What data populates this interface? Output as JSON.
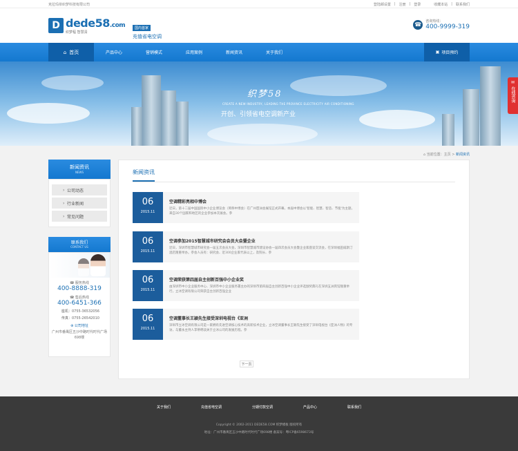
{
  "topbar": {
    "company": "克拉玛依织梦科技有限公司",
    "links": [
      "登陆邮设置",
      "注册",
      "登录",
      "收藏本站",
      "联系我们"
    ]
  },
  "header": {
    "logo_mark": "D",
    "logo_text": "dede58",
    "logo_suffix": ".com",
    "logo_tag": "织梦程  智慧清",
    "badge": "国内首家",
    "slogan": "充值省电空调",
    "hotline_label": "咨询热线：",
    "hotline": "400-9999-319"
  },
  "nav": {
    "home": "首页",
    "items": [
      "产品中心",
      "营销模式",
      "应用案例",
      "新闻资讯",
      "关于我们"
    ],
    "project": "项目预约"
  },
  "banner": {
    "title": "织梦58",
    "en": "CREATE A NEW INDUSTRY, LEADING THE PROVINCE ELECTRICITY AIR CONDITIONING",
    "sub": "开创、引领省电空调新产业"
  },
  "breadcrumb": {
    "prefix": "当前位置：主页 >",
    "current": "新闻资讯"
  },
  "sidebar": {
    "title": "新闻资讯",
    "title_en": "NEWS",
    "items": [
      "公司动态",
      "行业新闻",
      "常见问题"
    ],
    "contact_title": "联系我们",
    "contact_en": "CONTACT US",
    "service_label": "服务热线",
    "service_num": "400-8888-319",
    "after_label": "售后热线",
    "after_num": "400-6451-366",
    "landline": "座机：0755-36532056",
    "fax": "传真：0755-26542010",
    "addr_label": "公司地址",
    "addr": "广州市番禺区五沙中路时代时代广场698楼"
  },
  "main": {
    "title": "新闻资讯",
    "news": [
      {
        "day": "06",
        "month": "2015.11",
        "title": "空调精彩亮相中博会",
        "summary": "近日，第十二届中国国际中小企业博览会（简称中博会）在广州琶洲会展馆正式开幕，本届中博会以'智能、智慧、智造、节能'为主题，来自30个国家和地区的企业参加本次展会。参"
      },
      {
        "day": "06",
        "month": "2015.11",
        "title": "空调参加2015智慧城市研究会会员大会暨企业",
        "summary": "近日，深圳市智慧城市研究会一届五次会员大会，深圳市智慧城市建设协会一届四次会员大会暨企业家座谈交流会，在深圳福田威斯汀酒店隆重举办。参会人员有：研究会、近300企业家代表以上，及院长、参"
      },
      {
        "day": "06",
        "month": "2015.11",
        "title": "空调荣获第四届自主创新百强中小企业奖",
        "summary": "由深圳市中小企业服务中心、深圳市中小企业服务署主办的深圳市第四届自主创新百强中小企业评选颁奖典礼在深圳五洲宾馆隆重举行，立冰空调有限公司荣获自主创新百强企业"
      },
      {
        "day": "06",
        "month": "2015.11",
        "title": "空调董事长王颖先生接受深圳电视台《亚洲",
        "summary": "深圳市立冰空调有限公司是一家拥有先进空调核心技术的高新技术企业，立冰空调董事长王颖先生接受了深圳电视台《亚洲人物》的专访，与董永主持人李蒂韩谈关于立冰公司的发展历程。参"
      }
    ],
    "next": "下一页"
  },
  "float": "在线咨询",
  "footer": {
    "links": [
      "关于我们",
      "充值省电空调",
      "分期付款空调",
      "产品中心",
      "联系我们"
    ],
    "copyright": "Copyright © 2002-2011 DEDE58.COM 织梦模板 版权所有",
    "address": "地址：广州市番禺区五沙中路时代时代广场698楼      备案号：粤ICP备6598673号"
  }
}
